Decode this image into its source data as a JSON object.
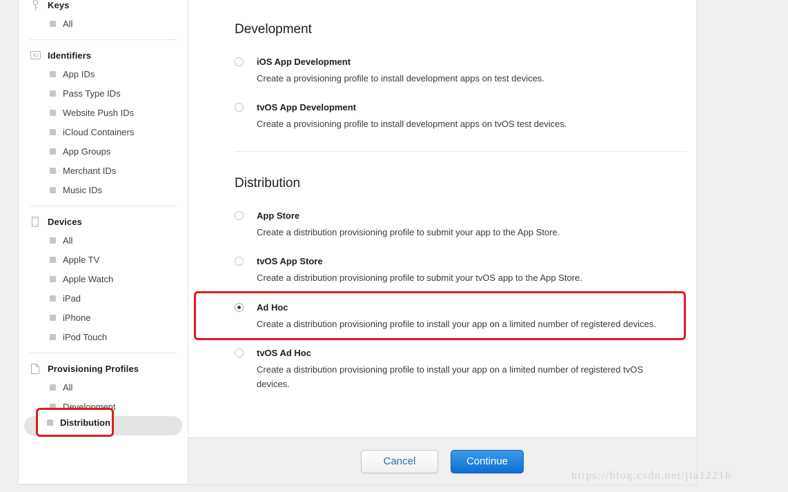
{
  "colors": {
    "accent_blue": "#0d6fd4",
    "annotation_red": "#e01b1b",
    "selected_item_bg": "#e4e4e4",
    "panel_bg": "#ffffff",
    "page_bg": "#efefef",
    "footer_bg": "#f0f0f0"
  },
  "sidebar": {
    "sections": [
      {
        "icon": "key-icon",
        "title": "Keys",
        "items": [
          {
            "label": "All",
            "selected": false
          }
        ]
      },
      {
        "icon": "id-badge-icon",
        "title": "Identifiers",
        "items": [
          {
            "label": "App IDs",
            "selected": false
          },
          {
            "label": "Pass Type IDs",
            "selected": false
          },
          {
            "label": "Website Push IDs",
            "selected": false
          },
          {
            "label": "iCloud Containers",
            "selected": false
          },
          {
            "label": "App Groups",
            "selected": false
          },
          {
            "label": "Merchant IDs",
            "selected": false
          },
          {
            "label": "Music IDs",
            "selected": false
          }
        ]
      },
      {
        "icon": "device-icon",
        "title": "Devices",
        "items": [
          {
            "label": "All",
            "selected": false
          },
          {
            "label": "Apple TV",
            "selected": false
          },
          {
            "label": "Apple Watch",
            "selected": false
          },
          {
            "label": "iPad",
            "selected": false
          },
          {
            "label": "iPhone",
            "selected": false
          },
          {
            "label": "iPod Touch",
            "selected": false
          }
        ]
      },
      {
        "icon": "document-icon",
        "title": "Provisioning Profiles",
        "items": [
          {
            "label": "All",
            "selected": false
          },
          {
            "label": "Development",
            "selected": false
          },
          {
            "label": "Distribution",
            "selected": true
          }
        ]
      }
    ]
  },
  "main": {
    "sections": [
      {
        "title": "Development",
        "options": [
          {
            "title": "iOS App Development",
            "desc": "Create a provisioning profile to install development apps on test devices.",
            "checked": false
          },
          {
            "title": "tvOS App Development",
            "desc": "Create a provisioning profile to install development apps on tvOS test devices.",
            "checked": false
          }
        ]
      },
      {
        "title": "Distribution",
        "options": [
          {
            "title": "App Store",
            "desc": "Create a distribution provisioning profile to submit your app to the App Store.",
            "checked": false
          },
          {
            "title": "tvOS App Store",
            "desc": "Create a distribution provisioning profile to submit your tvOS app to the App Store.",
            "checked": false
          },
          {
            "title": "Ad Hoc",
            "desc": "Create a distribution provisioning profile to install your app on a limited number of registered devices.",
            "checked": true
          },
          {
            "title": "tvOS Ad Hoc",
            "desc": "Create a distribution provisioning profile to install your app on a limited number of registered tvOS devices.",
            "checked": false
          }
        ]
      }
    ]
  },
  "footer": {
    "cancel_label": "Cancel",
    "continue_label": "Continue"
  },
  "annotations": {
    "distribution_label": "Distribution"
  },
  "watermark": {
    "text": "https://blog.csdn.net/jia12216"
  }
}
